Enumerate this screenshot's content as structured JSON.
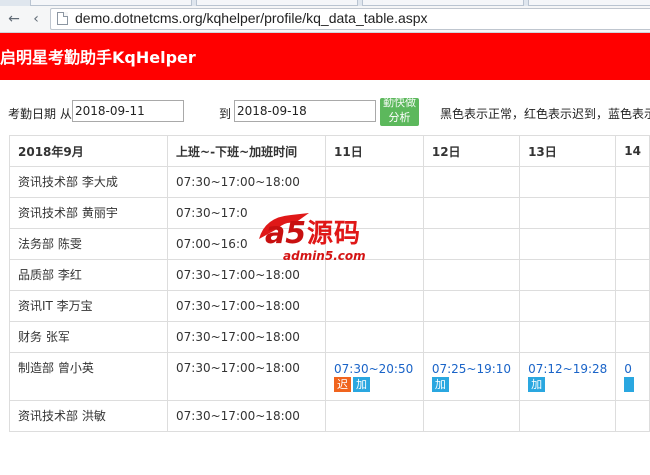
{
  "browser": {
    "url": "demo.dotnetcms.org/kqhelper/profile/kq_data_table.aspx"
  },
  "header": {
    "title": "启明星考勤助手KqHelper"
  },
  "filter": {
    "label": "考勤日期 从",
    "from_value": "2018-09-11",
    "to_label": "到",
    "to_value": "2018-09-18",
    "analyze_label_line1": "勤快做",
    "analyze_label_line2": "分析",
    "legend_note": "黑色表示正常，红色表示迟到，蓝色表示"
  },
  "table": {
    "headers": [
      "2018年9月",
      "上班~-下班~加班时间",
      "11日",
      "12日",
      "13日",
      "14"
    ],
    "rows": [
      {
        "name": "资讯技术部 李大成",
        "schedule": "07:30~17:00~18:00"
      },
      {
        "name": "资讯技术部 黄丽宇",
        "schedule": "07:30~17:0"
      },
      {
        "name": "法务部 陈雯",
        "schedule": "07:00~16:0"
      },
      {
        "name": "品质部 李红",
        "schedule": "07:30~17:00~18:00"
      },
      {
        "name": "资讯IT 李万宝",
        "schedule": "07:30~17:00~18:00"
      },
      {
        "name": "财务 张军",
        "schedule": "07:30~17:00~18:00"
      },
      {
        "name": "制造部 曾小英",
        "schedule": "07:30~17:00~18:00",
        "day11": {
          "time": "07:30~20:50",
          "tags": [
            "迟",
            "加"
          ]
        },
        "day12": {
          "time": "07:25~19:10",
          "tags": [
            "加"
          ]
        },
        "day13": {
          "time": "07:12~19:28",
          "tags": [
            "加"
          ]
        },
        "day14": {
          "time": "0"
        }
      },
      {
        "name": "资讯技术部 洪敏",
        "schedule": "07:30~17:00~18:00"
      }
    ]
  },
  "watermark": {
    "brand_cn": "源码",
    "url": "admin5.com",
    "logo_text": "a5"
  },
  "colors": {
    "header_bg": "#ff0000",
    "button_green": "#5cb85c",
    "late_tag": "#f0641e",
    "extra_tag": "#2aa7e0",
    "time_blue": "#1a64c8"
  }
}
